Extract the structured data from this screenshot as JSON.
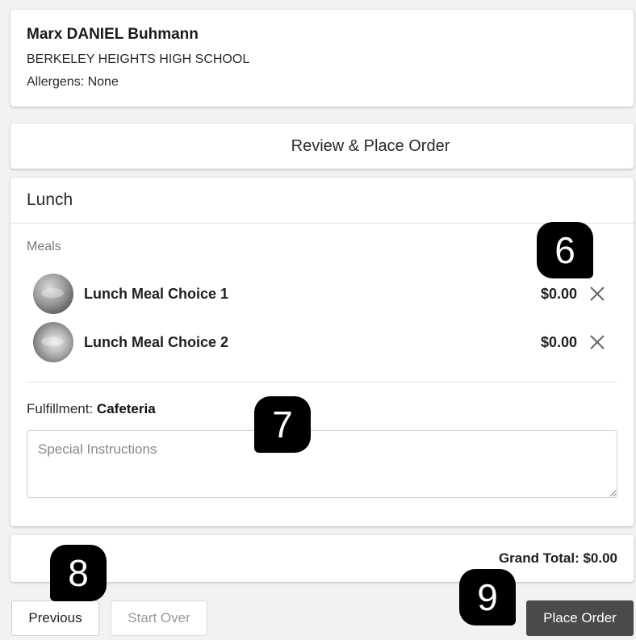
{
  "student": {
    "name": "Marx DANIEL Buhmann",
    "school": "BERKELEY HEIGHTS HIGH SCHOOL",
    "allergens": "Allergens: None"
  },
  "review": {
    "title": "Review & Place Order"
  },
  "lunch": {
    "title": "Lunch",
    "section_label": "Meals",
    "meals": [
      {
        "name": "Lunch Meal Choice 1",
        "price": "$0.00",
        "thumb_icon": "food-thumbnail"
      },
      {
        "name": "Lunch Meal Choice 2",
        "price": "$0.00",
        "thumb_icon": "food-thumbnail"
      }
    ],
    "remove_icon": "close-icon",
    "fulfillment_label": "Fulfillment:",
    "fulfillment_value": "Cafeteria",
    "instructions_placeholder": "Special Instructions",
    "instructions_value": ""
  },
  "totals": {
    "grand_total": "Grand Total: $0.00"
  },
  "buttons": {
    "previous": "Previous",
    "start_over": "Start Over",
    "place_order": "Place Order"
  },
  "callouts": [
    "6",
    "7",
    "8",
    "9"
  ],
  "colors": {
    "background": "#f2f2f2",
    "card": "#ffffff",
    "primary_button": "#4a4a4a",
    "callout": "#000000"
  }
}
